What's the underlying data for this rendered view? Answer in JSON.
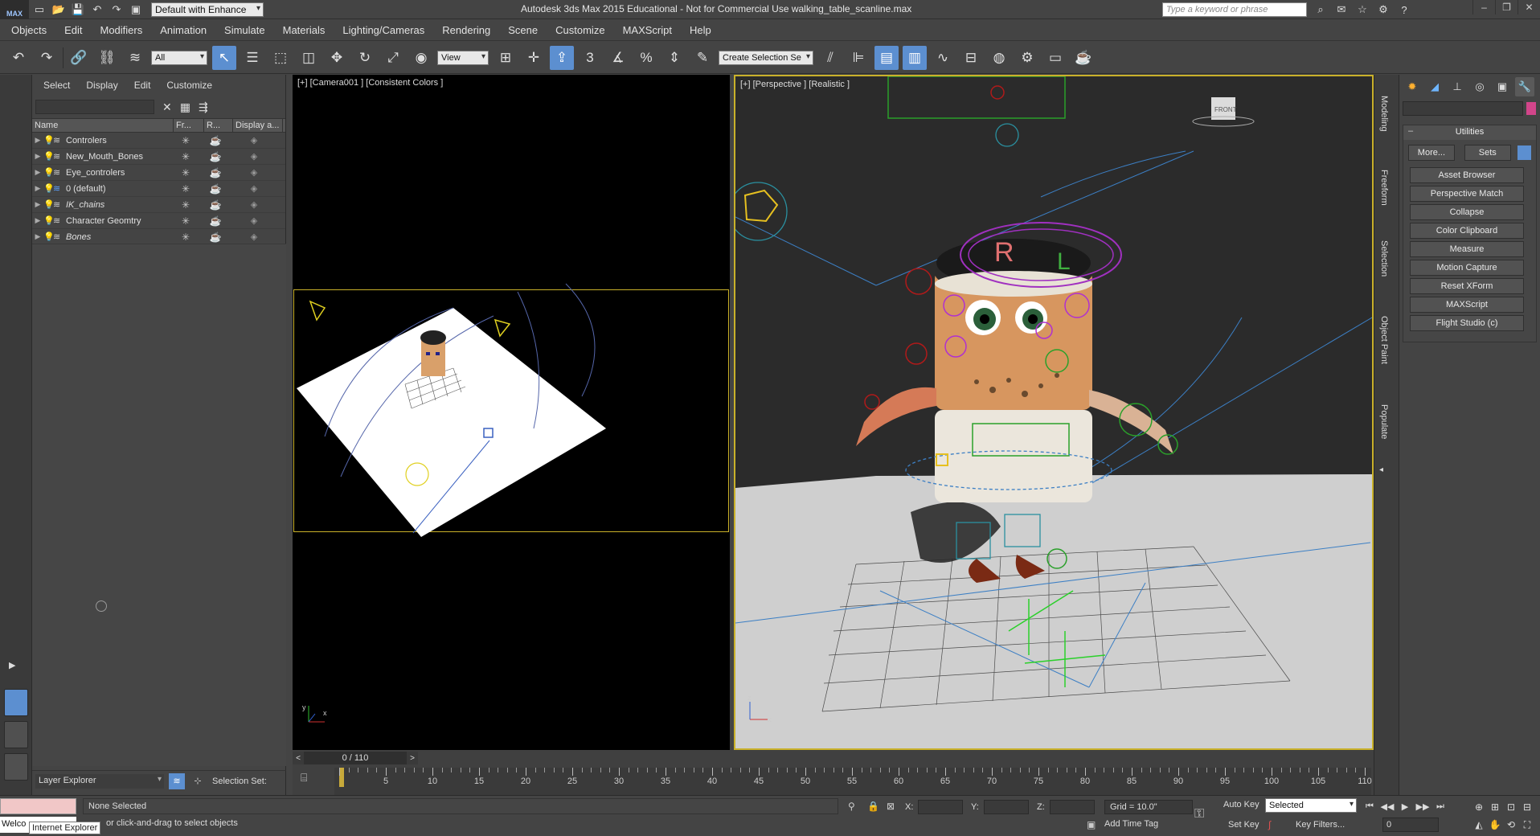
{
  "titlebar": {
    "logo": "MAX",
    "workspace": "Default with Enhance",
    "app_title": "Autodesk 3ds Max  2015  Educational - Not for Commercial Use   walking_table_scanline.max",
    "search_placeholder": "Type a keyword or phrase"
  },
  "menu": [
    "Objects",
    "Edit",
    "Modifiers",
    "Animation",
    "Simulate",
    "Materials",
    "Lighting/Cameras",
    "Rendering",
    "Scene",
    "Customize",
    "MAXScript",
    "Help"
  ],
  "toolbar": {
    "selection_filter": "All",
    "reference_coord": "View",
    "named_selection": "Create Selection Se",
    "snap_3": "3",
    "snap_pct": "%"
  },
  "explorer": {
    "menu": [
      "Select",
      "Display",
      "Edit",
      "Customize"
    ],
    "columns": [
      "Name",
      "Fr...",
      "R...",
      "Display a..."
    ],
    "layers": [
      {
        "name": "Controlers",
        "bulb": true,
        "italic": false,
        "render": false
      },
      {
        "name": "New_Mouth_Bones",
        "bulb": true,
        "italic": false,
        "render": false
      },
      {
        "name": "Eye_controlers",
        "bulb": true,
        "italic": false,
        "render": true
      },
      {
        "name": "0 (default)",
        "bulb": true,
        "italic": false,
        "render": true
      },
      {
        "name": "IK_chains",
        "bulb": false,
        "italic": true,
        "render": true
      },
      {
        "name": "Character Geomtry",
        "bulb": true,
        "italic": false,
        "render": true
      },
      {
        "name": "Bones",
        "bulb": false,
        "italic": true,
        "render": true
      }
    ],
    "footer_label": "Layer Explorer",
    "selection_set": "Selection Set:"
  },
  "viewports": {
    "left_label": "[+] [Camera001 ] [Consistent Colors ]",
    "right_label": "[+] [Perspective ] [Realistic ]"
  },
  "command_panel": {
    "side_tabs": [
      "Modeling",
      "Freeform",
      "Selection",
      "Object Paint",
      "Populate"
    ],
    "rollout_title": "Utilities",
    "more_btn": "More...",
    "sets_btn": "Sets",
    "utilities": [
      "Asset Browser",
      "Perspective Match",
      "Collapse",
      "Color Clipboard",
      "Measure",
      "Motion Capture",
      "Reset XForm",
      "MAXScript",
      "Flight Studio (c)"
    ],
    "swatch_color": "#d2458a"
  },
  "timeline": {
    "slider_text": "0 / 110",
    "ticks": [
      "0",
      "5",
      "10",
      "15",
      "20",
      "25",
      "30",
      "35",
      "40",
      "45",
      "50",
      "55",
      "60",
      "65",
      "70",
      "75",
      "80",
      "85",
      "90",
      "95",
      "100",
      "105",
      "110"
    ]
  },
  "status": {
    "selection": "None Selected",
    "prompt": "or click-and-drag to select objects",
    "maxscript_line": "Welco",
    "tooltip": "Internet Explorer",
    "x_label": "X:",
    "y_label": "Y:",
    "z_label": "Z:",
    "grid": "Grid = 10.0\"",
    "add_time_tag": "Add Time Tag",
    "auto_key": "Auto Key",
    "set_key": "Set Key",
    "selected_dd": "Selected",
    "key_filters": "Key Filters...",
    "frame": "0"
  }
}
